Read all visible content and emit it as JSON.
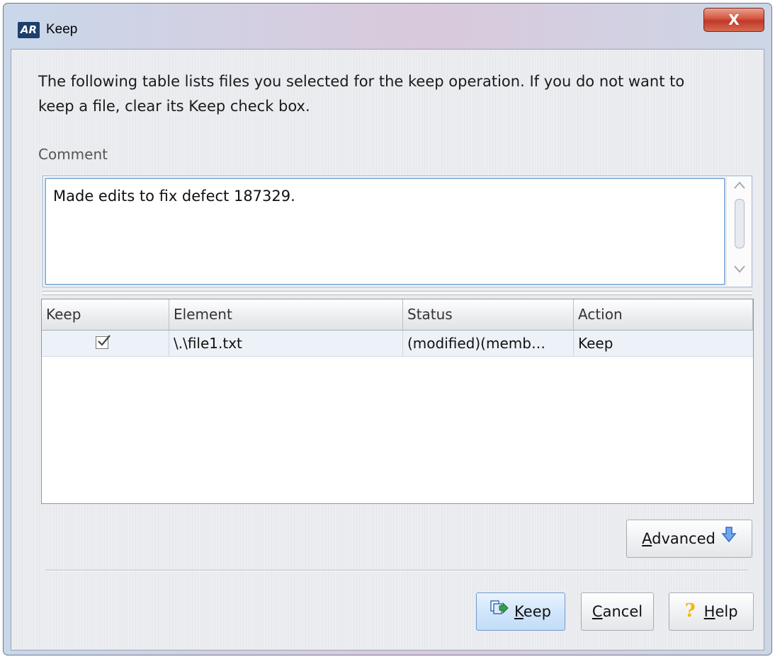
{
  "window": {
    "app_icon_text": "AR",
    "title": "Keep",
    "close_glyph": "X"
  },
  "description": "The following table lists files you selected for the keep operation. If you do not want to keep a file, clear its Keep check box.",
  "comment": {
    "label": "Comment",
    "value": "Made edits to fix defect 187329."
  },
  "table": {
    "columns": [
      "Keep",
      "Element",
      "Status",
      "Action"
    ],
    "rows": [
      {
        "keep_checked": true,
        "element": "\\.\\file1.txt",
        "status": "(modified)(memb…",
        "action": "Keep"
      }
    ]
  },
  "buttons": {
    "advanced": {
      "first": "A",
      "rest": "dvanced",
      "icon": "arrow-down-icon"
    },
    "keep": {
      "first": "K",
      "rest": "eep",
      "icon": "keep-files-icon"
    },
    "cancel": {
      "first": "C",
      "rest": "ancel"
    },
    "help": {
      "first": "H",
      "rest": "elp",
      "icon": "help-question-icon",
      "glyph": "?"
    }
  },
  "colors": {
    "accent": "#3d7edb",
    "close_button": "#c0392b",
    "help_icon": "#f0b800"
  }
}
